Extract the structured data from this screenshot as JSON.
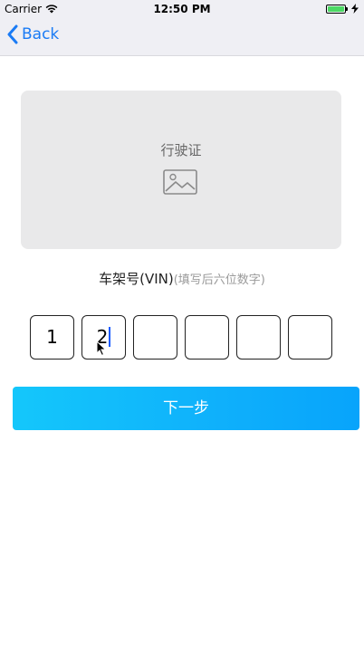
{
  "status_bar": {
    "carrier": "Carrier",
    "time": "12:50 PM",
    "battery_color": "#4cd964"
  },
  "nav": {
    "back_label": "Back",
    "accent_color": "#1a7bf5"
  },
  "license_card": {
    "title": "行驶证",
    "icon": "image-placeholder-icon"
  },
  "vin": {
    "label": "车架号(VIN)",
    "hint": "(填写后六位数字)",
    "digits": [
      "1",
      "2",
      "",
      "",
      "",
      ""
    ]
  },
  "actions": {
    "next_label": "下一步"
  }
}
